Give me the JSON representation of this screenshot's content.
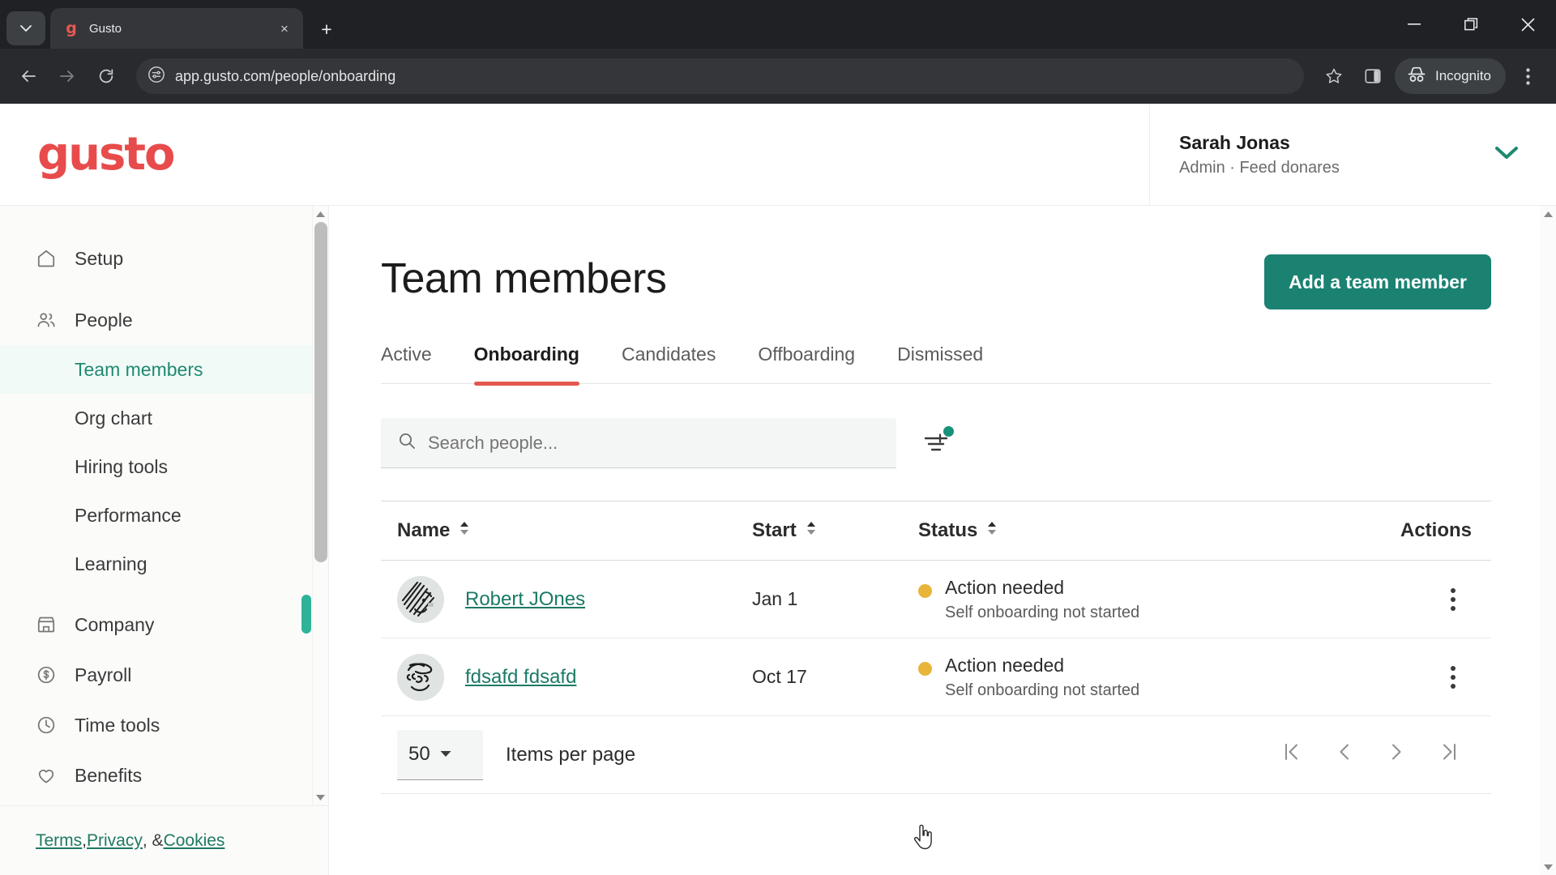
{
  "browser": {
    "tab": {
      "title": "Gusto",
      "favicon": "gusto-g-icon"
    },
    "tab_list_icon": "chevron-down-icon",
    "new_tab_label": "+",
    "close_tab_label": "×",
    "window": {
      "minimize": "—",
      "maximize": "❐",
      "close": "✕"
    },
    "nav": {
      "back": "←",
      "forward": "→",
      "reload": "⟳"
    },
    "url": "app.gusto.com/people/onboarding",
    "site_info_icon": "page-settings-icon",
    "bookmark_icon": "star-icon",
    "side_panel_icon": "side-panel-icon",
    "incognito_label": "Incognito",
    "menu_icon": "three-dot-menu-icon"
  },
  "header": {
    "logo_text": "gusto",
    "logo_color": "#e84b4b",
    "user_name": "Sarah Jonas",
    "user_role": "Admin · Feed donares",
    "caret_icon": "chevron-down-icon",
    "caret_color": "#1f8a70"
  },
  "sidebar": {
    "items": [
      {
        "label": "Setup",
        "icon": "home-icon",
        "type": "top"
      },
      {
        "label": "People",
        "icon": "people-icon",
        "type": "top"
      },
      {
        "label": "Team members",
        "type": "sub",
        "active": true
      },
      {
        "label": "Org chart",
        "type": "sub",
        "active": false
      },
      {
        "label": "Hiring tools",
        "type": "sub",
        "active": false
      },
      {
        "label": "Performance",
        "type": "sub",
        "active": false
      },
      {
        "label": "Learning",
        "type": "sub",
        "active": false
      },
      {
        "label": "Company",
        "icon": "store-icon",
        "type": "top"
      },
      {
        "label": "Payroll",
        "icon": "dollar-circle-icon",
        "type": "top"
      },
      {
        "label": "Time tools",
        "icon": "clock-icon",
        "type": "top"
      },
      {
        "label": "Benefits",
        "icon": "heart-icon",
        "type": "top"
      }
    ],
    "footer": {
      "terms": "Terms",
      "sep1": ", ",
      "privacy": "Privacy",
      "sep2": ", & ",
      "cookies": "Cookies"
    },
    "accent_color": "#2eb398"
  },
  "main": {
    "title": "Team members",
    "add_button": "Add a team member",
    "add_button_color": "#1b8272",
    "tabs": [
      {
        "label": "Active",
        "active": false
      },
      {
        "label": "Onboarding",
        "active": true
      },
      {
        "label": "Candidates",
        "active": false
      },
      {
        "label": "Offboarding",
        "active": false
      },
      {
        "label": "Dismissed",
        "active": false
      }
    ],
    "active_tab_underline_color": "#e4574f",
    "search": {
      "placeholder": "Search people...",
      "value": "",
      "icon": "search-icon"
    },
    "filter": {
      "icon": "filter-icon",
      "has_badge": true,
      "badge_color": "#19917a"
    },
    "table": {
      "columns": [
        {
          "label": "Name",
          "sortable": true
        },
        {
          "label": "Start",
          "sortable": true
        },
        {
          "label": "Status",
          "sortable": true
        },
        {
          "label": "Actions",
          "sortable": false
        }
      ],
      "rows": [
        {
          "avatar": "cartoon-face-avatar-1",
          "name": "Robert JOnes",
          "start": "Jan 1",
          "status": "Action needed",
          "status_detail": "Self onboarding not started",
          "status_color": "#e8b53a",
          "actions_icon": "kebab-menu-icon"
        },
        {
          "avatar": "cartoon-face-avatar-2",
          "name": "fdsafd fdsafd",
          "start": "Oct 17",
          "status": "Action needed",
          "status_detail": "Self onboarding not started",
          "status_color": "#e8b53a",
          "actions_icon": "kebab-menu-icon"
        }
      ]
    },
    "pagination": {
      "items_per_page_value": "50",
      "items_per_page_label": "Items per page",
      "first": "❘‹",
      "prev": "‹",
      "next": "›",
      "last": "›❘"
    }
  }
}
